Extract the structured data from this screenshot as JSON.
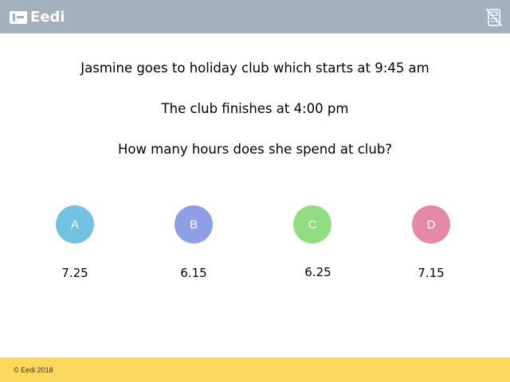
{
  "header": {
    "brand": "Eedi",
    "calculator_icon": "calculator-disabled-icon"
  },
  "question": {
    "line1": "Jasmine goes to holiday club which starts at 9:45 am",
    "line2": "The club finishes at 4:00 pm",
    "line3": "How many hours does she spend at club?"
  },
  "options": [
    {
      "letter": "A",
      "answer": "7.25",
      "color": "#74c2e2"
    },
    {
      "letter": "B",
      "answer": "6.15",
      "color": "#8f9fe5"
    },
    {
      "letter": "C",
      "answer": "6.25",
      "color": "#91de82"
    },
    {
      "letter": "D",
      "answer": "7.15",
      "color": "#e38aa6"
    }
  ],
  "footer": {
    "copyright": "© Eedi 2018"
  },
  "colors": {
    "header": "#a3b1bf",
    "footer": "#fcd85f"
  }
}
